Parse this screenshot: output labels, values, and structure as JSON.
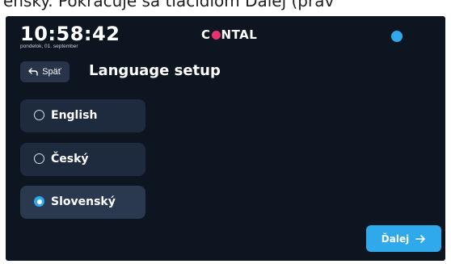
{
  "caption": {
    "text": "ensky. Pokračuje sa tlačidlom Ďalej (prav"
  },
  "header": {
    "time": "10:58:42",
    "date": "pondelok, 01. september",
    "logo_prefix": "C",
    "logo_suffix": "NTAL",
    "status_color": "#2fa8ec"
  },
  "toolbar": {
    "back_label": "Späť",
    "title": "Language setup"
  },
  "languages": [
    {
      "label": "English",
      "selected": false
    },
    {
      "label": "Český",
      "selected": false
    },
    {
      "label": "Slovenský",
      "selected": true
    }
  ],
  "footer": {
    "next_label": "Ďalej"
  },
  "colors": {
    "background": "#0d1520",
    "card": "#1e2b3e",
    "accent": "#2fa8ec",
    "logo_accent": "#e7336e"
  },
  "icons": {
    "back": "back-arrow-icon",
    "next": "right-arrow-icon",
    "status": "status-dot-icon"
  }
}
